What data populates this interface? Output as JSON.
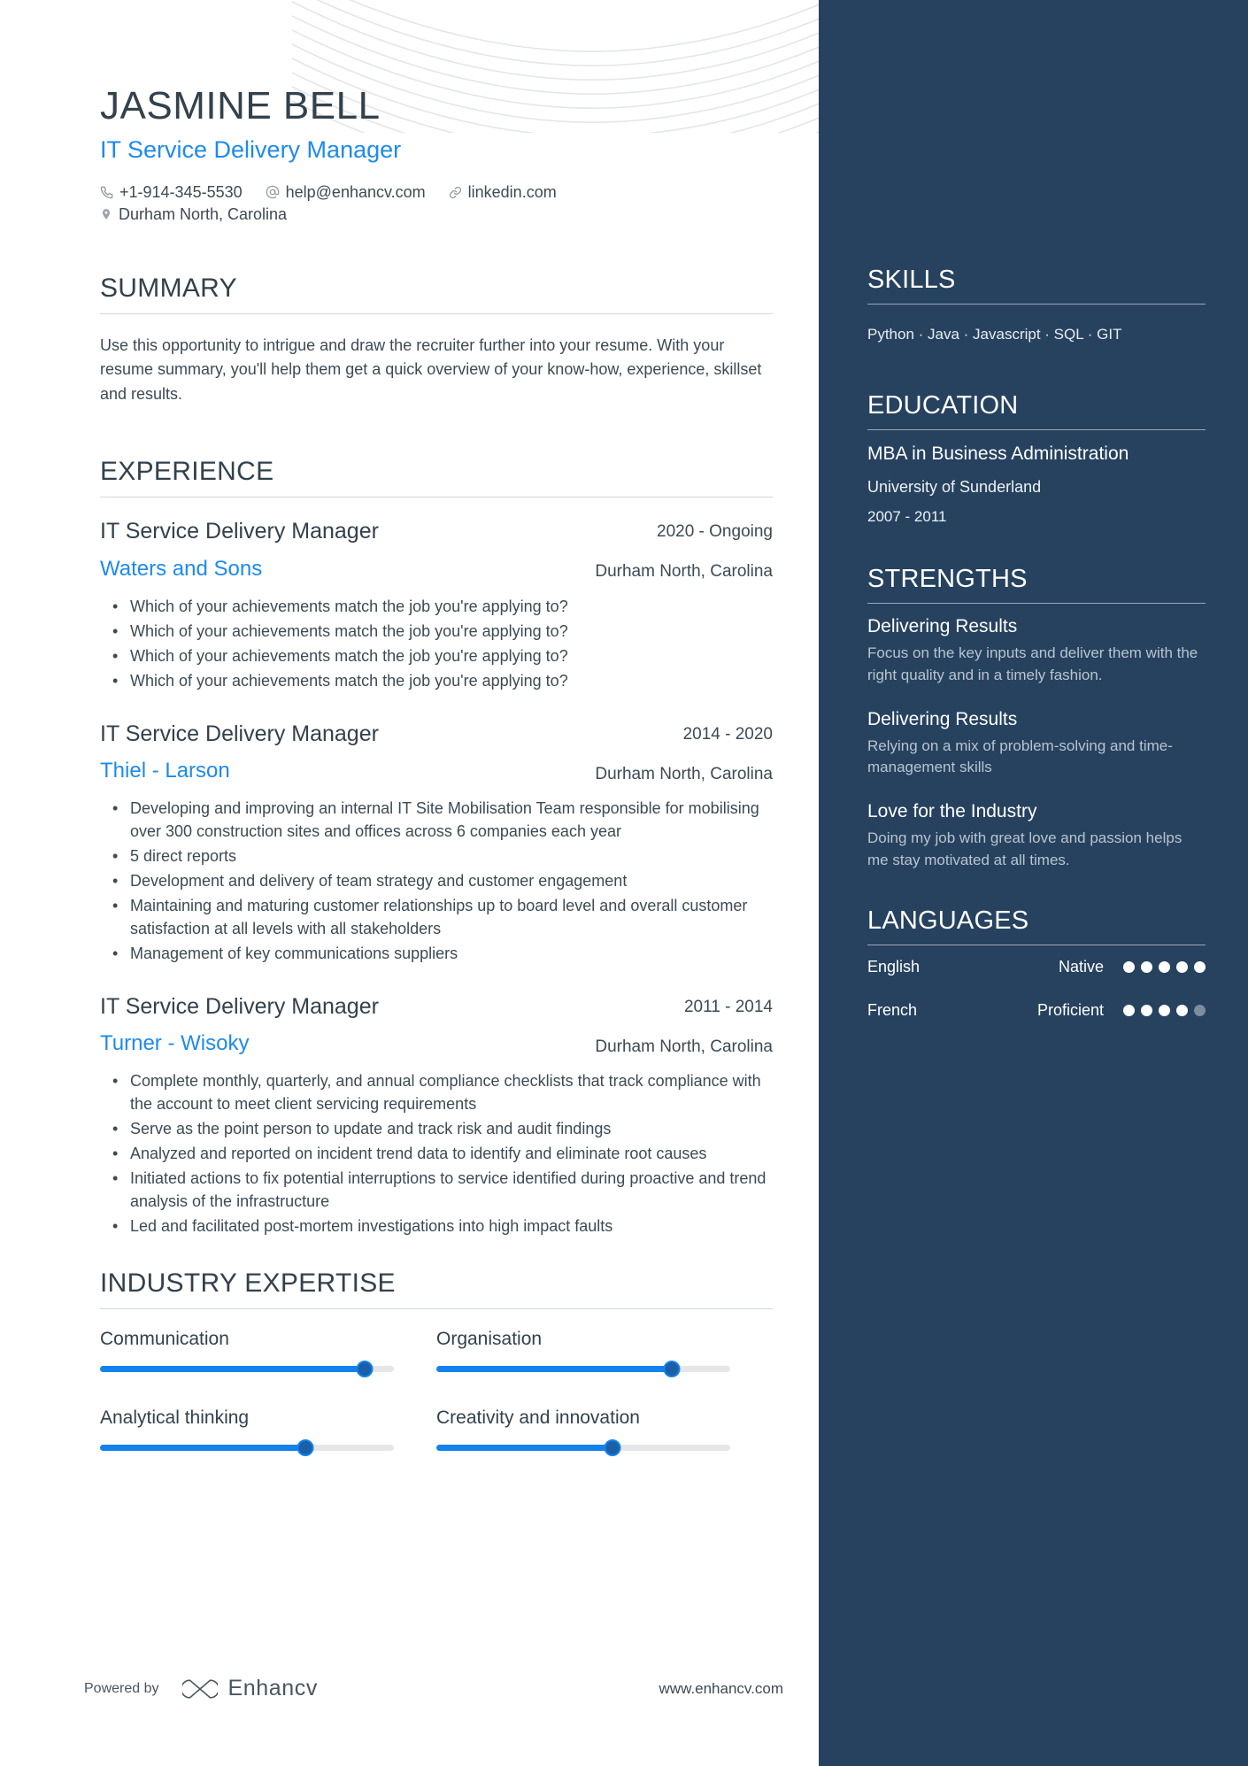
{
  "header": {
    "name": "JASMINE BELL",
    "role": "IT Service Delivery Manager",
    "phone": "+1-914-345-5530",
    "email": "help@enhancv.com",
    "link": "linkedin.com",
    "location": "Durham North, Carolina"
  },
  "summary": {
    "heading": "SUMMARY",
    "text": "Use this opportunity to intrigue and draw the recruiter further into your resume. With your resume summary, you'll help them get a quick overview of your know-how, experience, skillset and results."
  },
  "experience": {
    "heading": "EXPERIENCE",
    "jobs": [
      {
        "title": "IT Service Delivery Manager",
        "org": "Waters and Sons",
        "date": "2020 - Ongoing",
        "location": "Durham North, Carolina",
        "bullets": [
          "Which of your achievements match the job you're applying to?",
          "Which of your achievements match the job you're applying to?",
          "Which of your achievements match the job you're applying to?",
          "Which of your achievements match the job you're applying to?"
        ]
      },
      {
        "title": "IT Service Delivery Manager",
        "org": "Thiel - Larson",
        "date": "2014 - 2020",
        "location": "Durham North, Carolina",
        "bullets": [
          "Developing and improving an internal IT Site Mobilisation Team responsible for mobilising over 300 construction sites and offices across 6 companies each year",
          "5 direct reports",
          "Development and delivery of team strategy and customer engagement",
          "Maintaining and maturing customer relationships up to board level and overall customer satisfaction at all levels with all stakeholders",
          "Management of key communications suppliers"
        ]
      },
      {
        "title": "IT Service Delivery Manager",
        "org": "Turner - Wisoky",
        "date": "2011 - 2014",
        "location": "Durham North, Carolina",
        "bullets": [
          "Complete monthly, quarterly, and annual compliance checklists that track compliance with the account to meet client servicing requirements",
          "Serve as the point person to update and track risk and audit findings",
          "Analyzed and reported on incident trend data to identify and eliminate root causes",
          "Initiated actions to fix potential interruptions to service identified during proactive and trend analysis of the infrastructure",
          "Led and facilitated post-mortem investigations into high impact faults"
        ]
      }
    ]
  },
  "industry_expertise": {
    "heading": "INDUSTRY EXPERTISE",
    "items": [
      {
        "label": "Communication",
        "value": 90
      },
      {
        "label": "Organisation",
        "value": 80
      },
      {
        "label": "Analytical thinking",
        "value": 70
      },
      {
        "label": "Creativity and innovation",
        "value": 60
      }
    ]
  },
  "skills": {
    "heading": "SKILLS",
    "text": "Python · Java · Javascript · SQL · GIT"
  },
  "education": {
    "heading": "EDUCATION",
    "degree": "MBA in Business Administration",
    "school": "University of Sunderland",
    "date": "2007 - 2011"
  },
  "strengths": {
    "heading": "STRENGTHS",
    "items": [
      {
        "title": "Delivering Results",
        "desc": "Focus on the key inputs and deliver them with the right quality and in a timely fashion."
      },
      {
        "title": "Delivering Results",
        "desc": "Relying on a mix of problem-solving and time-management skills"
      },
      {
        "title": "Love for the Industry",
        "desc": "Doing my job with great love and passion helps me stay motivated at all times."
      }
    ]
  },
  "languages": {
    "heading": "LANGUAGES",
    "items": [
      {
        "name": "English",
        "level": "Native",
        "filled": 5,
        "total": 5
      },
      {
        "name": "French",
        "level": "Proficient",
        "filled": 4,
        "total": 5
      }
    ]
  },
  "footer": {
    "powered_by": "Powered by",
    "brand": "Enhancv",
    "site": "www.enhancv.com"
  },
  "colors": {
    "accent": "#1d8aed",
    "sidebar": "#26425f",
    "heading": "#33414c",
    "body": "#3d4a54"
  }
}
